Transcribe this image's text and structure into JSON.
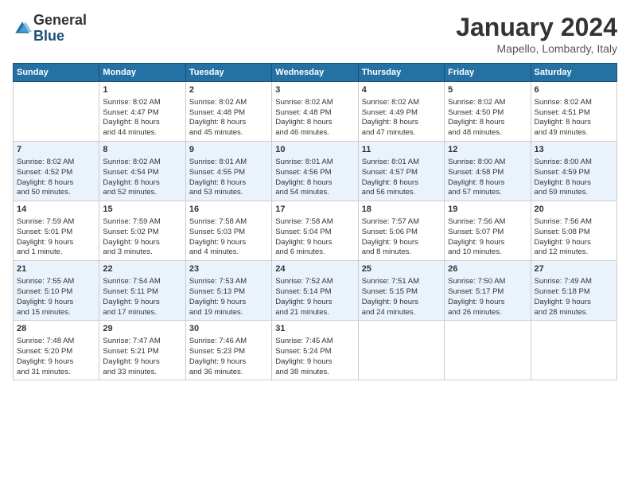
{
  "header": {
    "logo_general": "General",
    "logo_blue": "Blue",
    "month_title": "January 2024",
    "location": "Mapello, Lombardy, Italy"
  },
  "days_of_week": [
    "Sunday",
    "Monday",
    "Tuesday",
    "Wednesday",
    "Thursday",
    "Friday",
    "Saturday"
  ],
  "weeks": [
    {
      "cells": [
        {
          "day": "",
          "content": ""
        },
        {
          "day": "1",
          "content": "Sunrise: 8:02 AM\nSunset: 4:47 PM\nDaylight: 8 hours\nand 44 minutes."
        },
        {
          "day": "2",
          "content": "Sunrise: 8:02 AM\nSunset: 4:48 PM\nDaylight: 8 hours\nand 45 minutes."
        },
        {
          "day": "3",
          "content": "Sunrise: 8:02 AM\nSunset: 4:48 PM\nDaylight: 8 hours\nand 46 minutes."
        },
        {
          "day": "4",
          "content": "Sunrise: 8:02 AM\nSunset: 4:49 PM\nDaylight: 8 hours\nand 47 minutes."
        },
        {
          "day": "5",
          "content": "Sunrise: 8:02 AM\nSunset: 4:50 PM\nDaylight: 8 hours\nand 48 minutes."
        },
        {
          "day": "6",
          "content": "Sunrise: 8:02 AM\nSunset: 4:51 PM\nDaylight: 8 hours\nand 49 minutes."
        }
      ]
    },
    {
      "cells": [
        {
          "day": "7",
          "content": "Sunrise: 8:02 AM\nSunset: 4:52 PM\nDaylight: 8 hours\nand 50 minutes."
        },
        {
          "day": "8",
          "content": "Sunrise: 8:02 AM\nSunset: 4:54 PM\nDaylight: 8 hours\nand 52 minutes."
        },
        {
          "day": "9",
          "content": "Sunrise: 8:01 AM\nSunset: 4:55 PM\nDaylight: 8 hours\nand 53 minutes."
        },
        {
          "day": "10",
          "content": "Sunrise: 8:01 AM\nSunset: 4:56 PM\nDaylight: 8 hours\nand 54 minutes."
        },
        {
          "day": "11",
          "content": "Sunrise: 8:01 AM\nSunset: 4:57 PM\nDaylight: 8 hours\nand 56 minutes."
        },
        {
          "day": "12",
          "content": "Sunrise: 8:00 AM\nSunset: 4:58 PM\nDaylight: 8 hours\nand 57 minutes."
        },
        {
          "day": "13",
          "content": "Sunrise: 8:00 AM\nSunset: 4:59 PM\nDaylight: 8 hours\nand 59 minutes."
        }
      ]
    },
    {
      "cells": [
        {
          "day": "14",
          "content": "Sunrise: 7:59 AM\nSunset: 5:01 PM\nDaylight: 9 hours\nand 1 minute."
        },
        {
          "day": "15",
          "content": "Sunrise: 7:59 AM\nSunset: 5:02 PM\nDaylight: 9 hours\nand 3 minutes."
        },
        {
          "day": "16",
          "content": "Sunrise: 7:58 AM\nSunset: 5:03 PM\nDaylight: 9 hours\nand 4 minutes."
        },
        {
          "day": "17",
          "content": "Sunrise: 7:58 AM\nSunset: 5:04 PM\nDaylight: 9 hours\nand 6 minutes."
        },
        {
          "day": "18",
          "content": "Sunrise: 7:57 AM\nSunset: 5:06 PM\nDaylight: 9 hours\nand 8 minutes."
        },
        {
          "day": "19",
          "content": "Sunrise: 7:56 AM\nSunset: 5:07 PM\nDaylight: 9 hours\nand 10 minutes."
        },
        {
          "day": "20",
          "content": "Sunrise: 7:56 AM\nSunset: 5:08 PM\nDaylight: 9 hours\nand 12 minutes."
        }
      ]
    },
    {
      "cells": [
        {
          "day": "21",
          "content": "Sunrise: 7:55 AM\nSunset: 5:10 PM\nDaylight: 9 hours\nand 15 minutes."
        },
        {
          "day": "22",
          "content": "Sunrise: 7:54 AM\nSunset: 5:11 PM\nDaylight: 9 hours\nand 17 minutes."
        },
        {
          "day": "23",
          "content": "Sunrise: 7:53 AM\nSunset: 5:13 PM\nDaylight: 9 hours\nand 19 minutes."
        },
        {
          "day": "24",
          "content": "Sunrise: 7:52 AM\nSunset: 5:14 PM\nDaylight: 9 hours\nand 21 minutes."
        },
        {
          "day": "25",
          "content": "Sunrise: 7:51 AM\nSunset: 5:15 PM\nDaylight: 9 hours\nand 24 minutes."
        },
        {
          "day": "26",
          "content": "Sunrise: 7:50 AM\nSunset: 5:17 PM\nDaylight: 9 hours\nand 26 minutes."
        },
        {
          "day": "27",
          "content": "Sunrise: 7:49 AM\nSunset: 5:18 PM\nDaylight: 9 hours\nand 28 minutes."
        }
      ]
    },
    {
      "cells": [
        {
          "day": "28",
          "content": "Sunrise: 7:48 AM\nSunset: 5:20 PM\nDaylight: 9 hours\nand 31 minutes."
        },
        {
          "day": "29",
          "content": "Sunrise: 7:47 AM\nSunset: 5:21 PM\nDaylight: 9 hours\nand 33 minutes."
        },
        {
          "day": "30",
          "content": "Sunrise: 7:46 AM\nSunset: 5:23 PM\nDaylight: 9 hours\nand 36 minutes."
        },
        {
          "day": "31",
          "content": "Sunrise: 7:45 AM\nSunset: 5:24 PM\nDaylight: 9 hours\nand 38 minutes."
        },
        {
          "day": "",
          "content": ""
        },
        {
          "day": "",
          "content": ""
        },
        {
          "day": "",
          "content": ""
        }
      ]
    }
  ]
}
